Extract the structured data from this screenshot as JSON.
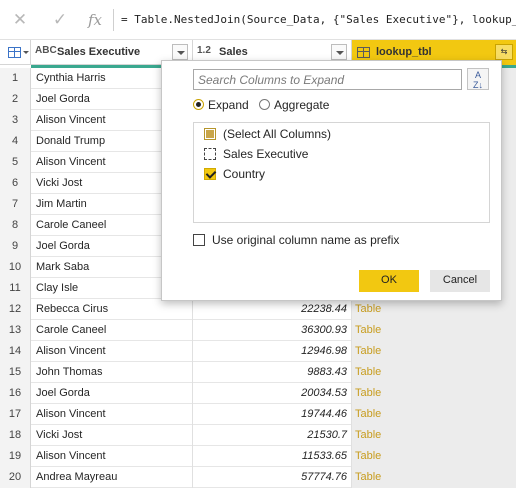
{
  "formula_bar": {
    "formula": "= Table.NestedJoin(Source_Data, {\"Sales Executive\"}, lookup_tbl, {\"Sales Executive\"}, \"lookup_tbl\", JoinKind.LeftOuter)",
    "fx_label": "fx"
  },
  "columns": [
    {
      "type_label": "ABC",
      "name": "Sales Executive"
    },
    {
      "type_label": "1.2",
      "name": "Sales"
    },
    {
      "type_label": "",
      "name": "lookup_tbl"
    }
  ],
  "rows": [
    {
      "n": "1",
      "exec": "Cynthia Harris",
      "sales": "",
      "lookup": ""
    },
    {
      "n": "2",
      "exec": "Joel Gorda",
      "sales": "",
      "lookup": ""
    },
    {
      "n": "3",
      "exec": "Alison Vincent",
      "sales": "",
      "lookup": ""
    },
    {
      "n": "4",
      "exec": "Donald Trump",
      "sales": "",
      "lookup": ""
    },
    {
      "n": "5",
      "exec": "Alison Vincent",
      "sales": "",
      "lookup": ""
    },
    {
      "n": "6",
      "exec": "Vicki Jost",
      "sales": "",
      "lookup": ""
    },
    {
      "n": "7",
      "exec": "Jim Martin",
      "sales": "",
      "lookup": ""
    },
    {
      "n": "8",
      "exec": "Carole Caneel",
      "sales": "",
      "lookup": ""
    },
    {
      "n": "9",
      "exec": "Joel Gorda",
      "sales": "",
      "lookup": ""
    },
    {
      "n": "10",
      "exec": "Mark Saba",
      "sales": "",
      "lookup": ""
    },
    {
      "n": "11",
      "exec": "Clay Isle",
      "sales": "",
      "lookup": ""
    },
    {
      "n": "12",
      "exec": "Rebecca Cirus",
      "sales": "22238.44",
      "lookup": "Table"
    },
    {
      "n": "13",
      "exec": "Carole Caneel",
      "sales": "36300.93",
      "lookup": "Table"
    },
    {
      "n": "14",
      "exec": "Alison Vincent",
      "sales": "12946.98",
      "lookup": "Table"
    },
    {
      "n": "15",
      "exec": "John Thomas",
      "sales": "9883.43",
      "lookup": "Table"
    },
    {
      "n": "16",
      "exec": "Joel Gorda",
      "sales": "20034.53",
      "lookup": "Table"
    },
    {
      "n": "17",
      "exec": "Alison Vincent",
      "sales": "19744.46",
      "lookup": "Table"
    },
    {
      "n": "18",
      "exec": "Vicki Jost",
      "sales": "21530.7",
      "lookup": "Table"
    },
    {
      "n": "19",
      "exec": "Alison Vincent",
      "sales": "11533.65",
      "lookup": "Table"
    },
    {
      "n": "20",
      "exec": "Andrea Mayreau",
      "sales": "57774.76",
      "lookup": "Table"
    }
  ],
  "expand_popup": {
    "search_placeholder": "Search Columns to Expand",
    "sort_icon": "sort-az-icon",
    "options": {
      "expand": "Expand",
      "aggregate": "Aggregate"
    },
    "columns": [
      {
        "label": "(Select All Columns)",
        "state": "partial"
      },
      {
        "label": "Sales Executive",
        "state": "unchecked"
      },
      {
        "label": "Country",
        "state": "checked"
      }
    ],
    "prefix_label": "Use original column name as prefix",
    "ok": "OK",
    "cancel": "Cancel"
  },
  "colors": {
    "accent": "#f2c811",
    "table_link": "#c89d1f",
    "quality_bar": "#3aa88f"
  }
}
